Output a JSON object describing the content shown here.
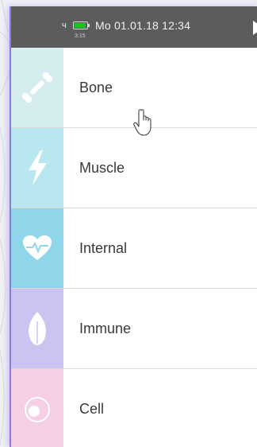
{
  "status": {
    "signal": "ч",
    "battery_time": "3:15",
    "battery_level": 0.8,
    "datetime": "Mo 01.01.18 12:34"
  },
  "menu": {
    "items": [
      {
        "label": "Bone",
        "icon": "bone-icon",
        "color": "#d6edf0"
      },
      {
        "label": "Muscle",
        "icon": "lightning-icon",
        "color": "#b9e7ef"
      },
      {
        "label": "Internal",
        "icon": "heart-pulse-icon",
        "color": "#8fd6ea"
      },
      {
        "label": "Immune",
        "icon": "leaf-icon",
        "color": "#cdc3f1"
      },
      {
        "label": "Cell",
        "icon": "cell-icon",
        "color": "#f6cfe7"
      }
    ]
  },
  "cursor": {
    "icon": "hand-pointer-icon"
  }
}
